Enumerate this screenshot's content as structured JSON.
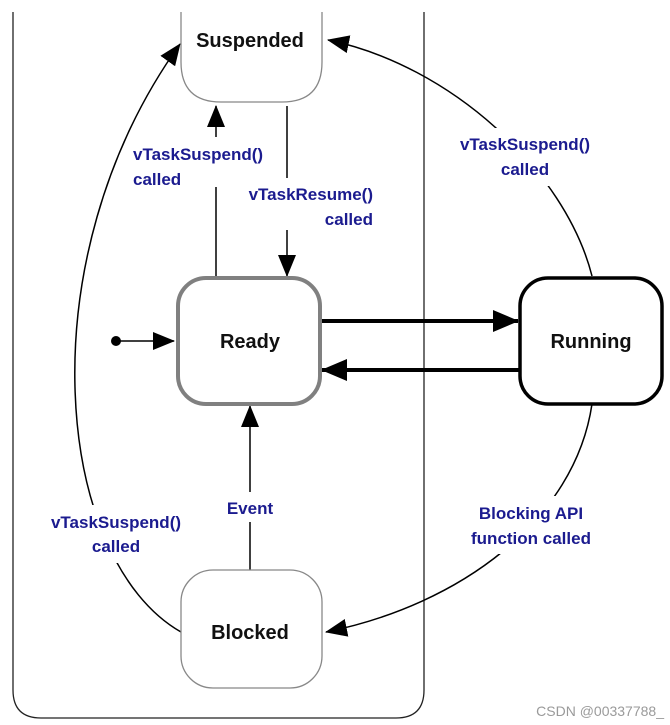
{
  "states": {
    "suspended": "Suspended",
    "ready": "Ready",
    "running": "Running",
    "blocked": "Blocked"
  },
  "transitions": {
    "ready_to_suspended": [
      "vTaskSuspend()",
      "called"
    ],
    "suspended_to_ready": [
      "vTaskResume()",
      "called"
    ],
    "running_to_suspended": [
      "vTaskSuspend()",
      "called"
    ],
    "blocked_to_suspended": [
      "vTaskSuspend()",
      "called"
    ],
    "blocked_to_ready": [
      "Event"
    ],
    "running_to_blocked": [
      "Blocking API",
      "function called"
    ]
  },
  "watermark": "CSDN @00337788_",
  "colors": {
    "label": "#1b1b8f",
    "ready_border": "#808080",
    "line": "#000000"
  }
}
